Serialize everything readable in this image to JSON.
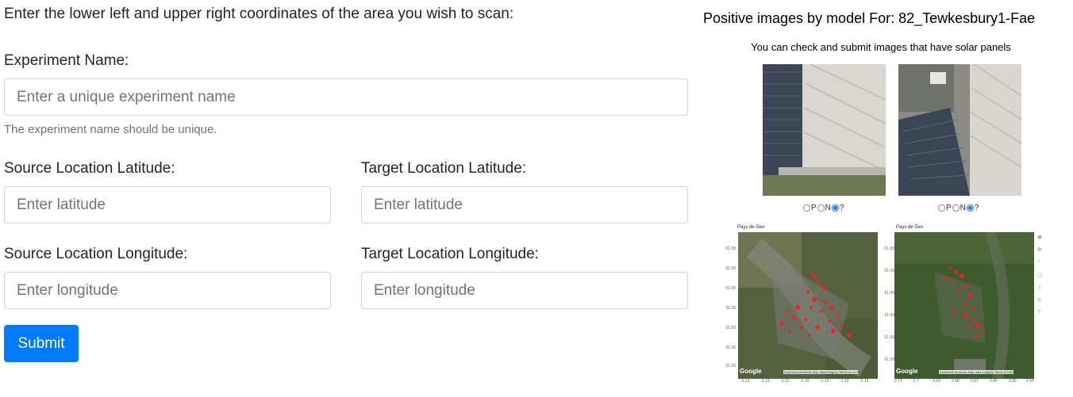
{
  "form": {
    "intro": "Enter the lower left and upper right coordinates of the area you wish to scan:",
    "experiment_label": "Experiment Name:",
    "experiment_placeholder": "Enter a unique experiment name",
    "experiment_help": "The experiment name should be unique.",
    "source_lat_label": "Source Location Latitude:",
    "source_lat_placeholder": "Enter latitude",
    "target_lat_label": "Target Location Latitude:",
    "target_lat_placeholder": "Enter latitude",
    "source_lon_label": "Source Location Longitude:",
    "source_lon_placeholder": "Enter longitude",
    "target_lon_label": "Target Location Longitude:",
    "target_lon_placeholder": "Enter longitude",
    "submit_label": "Submit"
  },
  "panel": {
    "title": "Positive images by model For: 82_Tewkesbury1-Fae",
    "subtitle": "You can check and submit images that have solar panels",
    "images": [
      {
        "radio_options": [
          "P",
          "N",
          "?"
        ],
        "selected": "?"
      },
      {
        "radio_options": [
          "P",
          "N",
          "?"
        ],
        "selected": "?"
      }
    ],
    "maps": [
      {
        "title": "Pays de Gex",
        "watermark": "Google",
        "attribution": "Keyboard shortcuts  Map data  Imagery  Terms of Use",
        "y_ticks": [
          "51.99",
          "51.99",
          "51.99",
          "51.99",
          "51.99",
          "51.99",
          "51.99"
        ],
        "x_ticks": [
          "-1.13",
          "-1.13",
          "-1.13",
          "-1.13",
          "-1.13",
          "-1.13",
          "-1.13"
        ]
      },
      {
        "title": "Pays de Gex",
        "watermark": "Google",
        "attribution": "Keyboard shortcuts  Map data  Imagery  Terms of Use",
        "y_ticks": [
          "51.99",
          "51.99",
          "51.99",
          "51.99",
          "51.99",
          "51.99"
        ],
        "x_ticks": [
          "2.71",
          "2.7",
          "2.69",
          "2.68",
          "2.67",
          "2.66",
          "2.65",
          "2.64"
        ]
      }
    ],
    "colors": {
      "panel_dark": "#3a4a5c",
      "roof": "#d8d6cf",
      "solar_marks": "#e8252a",
      "grass": "#6b7a52"
    }
  }
}
